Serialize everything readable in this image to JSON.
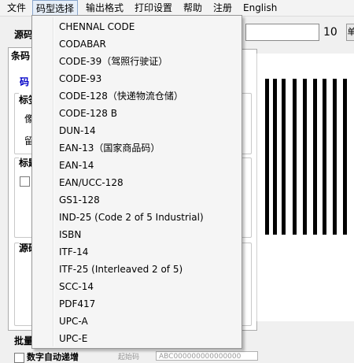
{
  "menubar": {
    "items": [
      "文件",
      "码型选择",
      "输出格式",
      "打印设置",
      "帮助",
      "注册",
      "English"
    ]
  },
  "background": {
    "source_label": "源码",
    "count_value": "10",
    "side_button": "单",
    "tab_label": "条码",
    "code_label": "码",
    "group1_label": "标签",
    "pixel_label": "像",
    "margin_label": "留",
    "group2_label": "标题",
    "group3_label": "源码",
    "batch_label": "批量",
    "auto_label": "数字自动递增",
    "faint_label": "起始码",
    "faint_input": "ABC000000000000000"
  },
  "dropdown": {
    "items": [
      "CHENNAL CODE",
      "CODABAR",
      "CODE-39（驾照行驶证）",
      "CODE-93",
      "CODE-128（快递物流仓储）",
      "CODE-128 B",
      "DUN-14",
      "EAN-13（国家商品码）",
      "EAN-14",
      "EAN/UCC-128",
      "GS1-128",
      "IND-25 (Code 2 of 5 Industrial)",
      "ISBN",
      "ITF-14",
      "ITF-25 (Interleaved 2 of 5)",
      "SCC-14",
      "PDF417",
      "UPC-A",
      "UPC-E"
    ]
  }
}
